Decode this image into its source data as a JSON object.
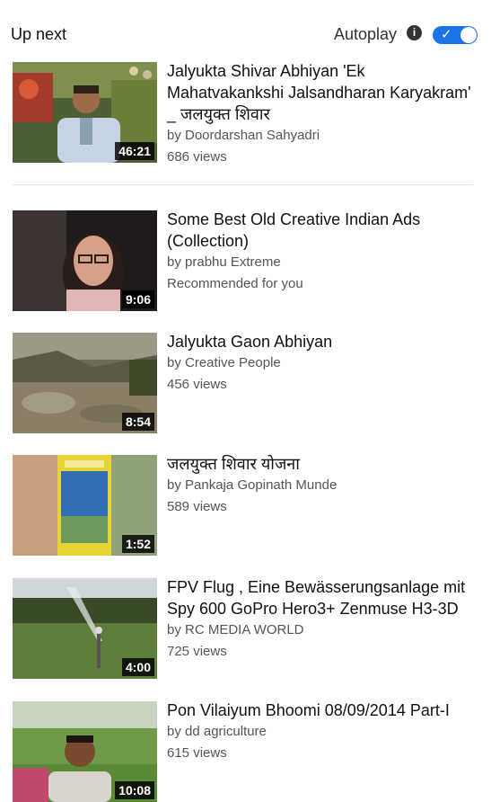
{
  "header": {
    "up_next": "Up next",
    "autoplay_label": "Autoplay",
    "info_glyph": "i",
    "toggle_check": "✓",
    "autoplay_on": true,
    "toggle_color": "#1a73e8"
  },
  "videos": [
    {
      "title": "Jalyukta Shivar Abhiyan 'Ek Mahatvakankshi Jalsandharan Karyakram' _ जलयुक्त शिवार",
      "channel": "by Doordarshan Sahyadri",
      "meta": "686 views",
      "duration": "46:21"
    },
    {
      "title": "Some Best Old Creative Indian Ads (Collection)",
      "channel": "by prabhu Extreme",
      "meta": "Recommended for you",
      "duration": "9:06"
    },
    {
      "title": "Jalyukta Gaon Abhiyan",
      "channel": "by Creative People",
      "meta": "456 views",
      "duration": "8:54"
    },
    {
      "title": "जलयुक्त शिवार योजना",
      "channel": "by Pankaja Gopinath Munde",
      "meta": "589 views",
      "duration": "1:52"
    },
    {
      "title": "FPV Flug , Eine Bewässerungsanlage mit Spy 600 GoPro Hero3+ Zenmuse H3-3D",
      "channel": "by RC MEDIA WORLD",
      "meta": "725 views",
      "duration": "4:00"
    },
    {
      "title": "Pon Vilaiyum Bhoomi 08/09/2014 Part-I",
      "channel": "by dd agriculture",
      "meta": "615 views",
      "duration": "10:08"
    }
  ]
}
